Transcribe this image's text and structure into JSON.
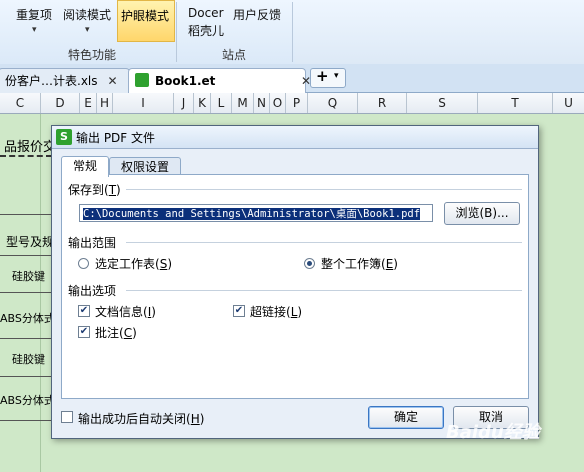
{
  "ribbon": {
    "buttons": [
      {
        "label": "重复项",
        "has_caret": true
      },
      {
        "label": "阅读模式",
        "has_caret": true
      },
      {
        "label": "护眼模式",
        "active": true
      },
      {
        "label": "Docer",
        "label2": "稻壳儿"
      },
      {
        "label": "用户反馈"
      }
    ],
    "group_labels": [
      "特色功能",
      "站点"
    ],
    "caret": "▾"
  },
  "tabs": [
    {
      "label": "份客户…计表.xls",
      "close": "✕"
    },
    {
      "label": "Book1.et",
      "close": "✕",
      "active": true
    }
  ],
  "add_tab": {
    "plus": "+",
    "caret": "▾"
  },
  "columns": [
    "C",
    "D",
    "E",
    "H",
    "I",
    "J",
    "K",
    "L",
    "M",
    "N",
    "O",
    "P",
    "Q",
    "R",
    "S",
    "T",
    "U"
  ],
  "sheet_cells": [
    "品报价交",
    "型号及规",
    "硅胶键",
    "ABS分体式",
    "硅胶键",
    "ABS分体式"
  ],
  "dialog": {
    "title": "输出 PDF 文件",
    "app_icon": "S",
    "close": "✕",
    "tabs": [
      "常规",
      "权限设置"
    ],
    "save_to": {
      "label": "保存到",
      "hotkey": "T",
      "path": "C:\\Documents and Settings\\Administrator\\桌面\\Book1.pdf",
      "browse": "浏览(B)..."
    },
    "range": {
      "label": "输出范围",
      "options": [
        {
          "label": "选定工作表",
          "hotkey": "S",
          "selected": false
        },
        {
          "label": "整个工作簿",
          "hotkey": "E",
          "selected": true
        }
      ]
    },
    "options": {
      "label": "输出选项",
      "items": [
        {
          "label": "文档信息",
          "hotkey": "I",
          "checked": true
        },
        {
          "label": "超链接",
          "hotkey": "L",
          "checked": true
        },
        {
          "label": "批注",
          "hotkey": "C",
          "checked": true
        }
      ]
    },
    "auto_close": {
      "label": "输出成功后自动关闭",
      "hotkey": "H",
      "checked": false
    },
    "ok": "确定",
    "cancel": "取消"
  },
  "watermark": "Baidu经验"
}
